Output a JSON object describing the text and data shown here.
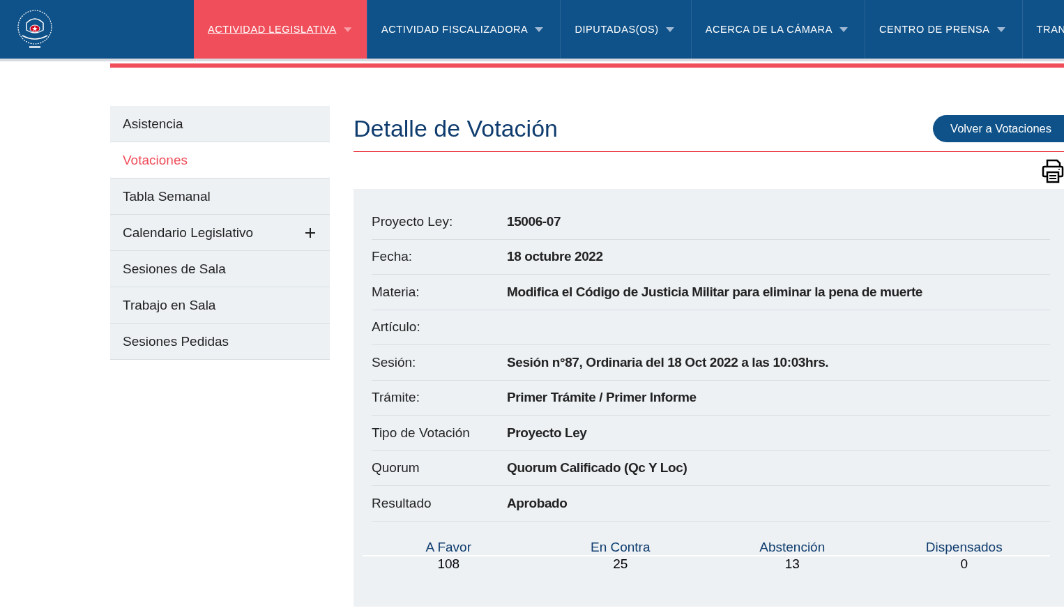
{
  "nav": [
    {
      "label": "ACTIVIDAD LEGISLATIVA",
      "selected": true
    },
    {
      "label": "ACTIVIDAD FISCALIZADORA",
      "selected": false
    },
    {
      "label": "DIPUTADAS(OS)",
      "selected": false
    },
    {
      "label": "ACERCA DE LA CÁMARA",
      "selected": false
    },
    {
      "label": "CENTRO DE PRENSA",
      "selected": false
    },
    {
      "label": "TRAN",
      "selected": false
    }
  ],
  "sidebar": {
    "items": [
      {
        "label": "Asistencia",
        "selected": false,
        "expandable": false
      },
      {
        "label": "Votaciones",
        "selected": true,
        "expandable": false
      },
      {
        "label": "Tabla Semanal",
        "selected": false,
        "expandable": false
      },
      {
        "label": "Calendario Legislativo",
        "selected": false,
        "expandable": true
      },
      {
        "label": "Sesiones de Sala",
        "selected": false,
        "expandable": false
      },
      {
        "label": "Trabajo en Sala",
        "selected": false,
        "expandable": false
      },
      {
        "label": "Sesiones Pedidas",
        "selected": false,
        "expandable": false
      }
    ]
  },
  "page_title": "Detalle de Votación",
  "back_button": "Volver a Votaciones",
  "details": [
    {
      "label": "Proyecto Ley:",
      "value": "15006-07"
    },
    {
      "label": "Fecha:",
      "value": "18 octubre 2022"
    },
    {
      "label": "Materia:",
      "value": "Modifica el Código de Justicia Militar para eliminar la pena de muerte"
    },
    {
      "label": "Artículo:"
    },
    {
      "label": "Sesión:",
      "value": "Sesión n°87, Ordinaria del 18 Oct 2022 a las 10:03hrs."
    },
    {
      "label": "Trámite:",
      "value": "Primer Trámite / Primer Informe"
    },
    {
      "label": "Tipo de Votación",
      "value": "Proyecto Ley"
    },
    {
      "label": "Quorum",
      "value": "Quorum Calificado (Qc Y Loc)"
    },
    {
      "label": "Resultado",
      "value": "Aprobado"
    }
  ],
  "totals": [
    {
      "label": "A Favor",
      "count": "108"
    },
    {
      "label": "En Contra",
      "count": "25"
    },
    {
      "label": "Abstención",
      "count": "13"
    },
    {
      "label": "Dispensados",
      "count": "0"
    }
  ]
}
